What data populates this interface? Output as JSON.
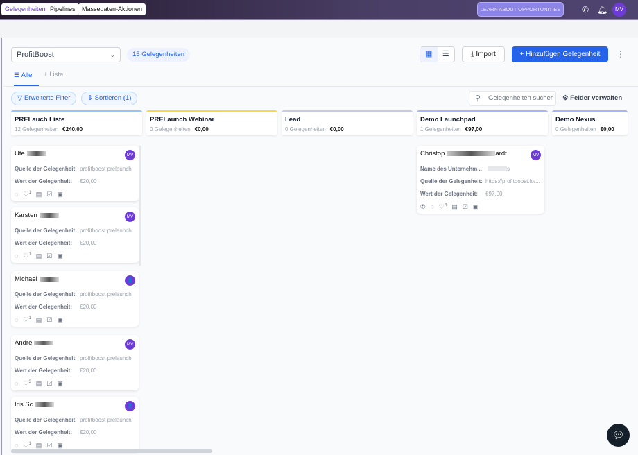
{
  "nav": {
    "tabs": [
      "Gelegenheiten",
      "Pipelines",
      "Massedaten-Aktionen"
    ],
    "learn": "LEARN ABOUT OPPORTUNITIES",
    "avatar": "MV"
  },
  "toolbar": {
    "pipeline": "ProfitBoost",
    "count": "15 Gelegenheiten",
    "import": "Import",
    "add": "Hinzufügen Gelegenheit"
  },
  "view_tabs": {
    "alle": "Alle",
    "liste": "Liste"
  },
  "filters": {
    "filter": "Erweiterte Filter",
    "sort": "Sortieren (1)",
    "search_placeholder": "Gelegenheiten sucher",
    "fields": "Felder verwalten"
  },
  "columns": [
    {
      "title": "PRELauch Liste",
      "count": "12 Gelegenheiten",
      "value": "€240,00",
      "color": "#93c5fd"
    },
    {
      "title": "PRELaunch Webinar",
      "count": "0 Gelegenheiten",
      "value": "€0,00",
      "color": "#fcd34d"
    },
    {
      "title": "Lead",
      "count": "0 Gelegenheiten",
      "value": "€0,00",
      "color": "#c7c9e8"
    },
    {
      "title": "Demo Launchpad",
      "count": "1 Gelegenheiten",
      "value": "€97,00",
      "color": "#a5b4fc"
    },
    {
      "title": "Demo Nexus",
      "count": "0 Gelegenheiten",
      "value": "€0,00",
      "color": "#a5b4fc"
    }
  ],
  "labels": {
    "source": "Quelle der Gelegenheit:",
    "value": "Wert der Gelegenheit:",
    "company": "Name des Unternehm..."
  },
  "cards": [
    {
      "name": "Ute",
      "avatar": "MV",
      "source": "profitboost prelaunch",
      "value": "€20,00",
      "badge": "1"
    },
    {
      "name": "Karsten",
      "avatar": "MV",
      "source": "profitboost prelaunch",
      "value": "€20,00",
      "badge": "1"
    },
    {
      "name": "Michael",
      "avatar": "👤",
      "source": "profitboost prelaunch",
      "value": "€20,00",
      "badge": "1"
    },
    {
      "name": "Andre",
      "avatar": "MV",
      "source": "profitboost prelaunch",
      "value": "€20,00",
      "badge": "3"
    },
    {
      "name": "Iris Sc",
      "avatar": "👤",
      "source": "profitboost prelaunch",
      "value": "€20,00",
      "badge": "1"
    }
  ],
  "demo_card": {
    "name": "Christop",
    "name_end": "ardt",
    "avatar": "MV",
    "company": "s",
    "source": "https://profitboost.io/...",
    "value": "€97,00",
    "badge": "4"
  }
}
